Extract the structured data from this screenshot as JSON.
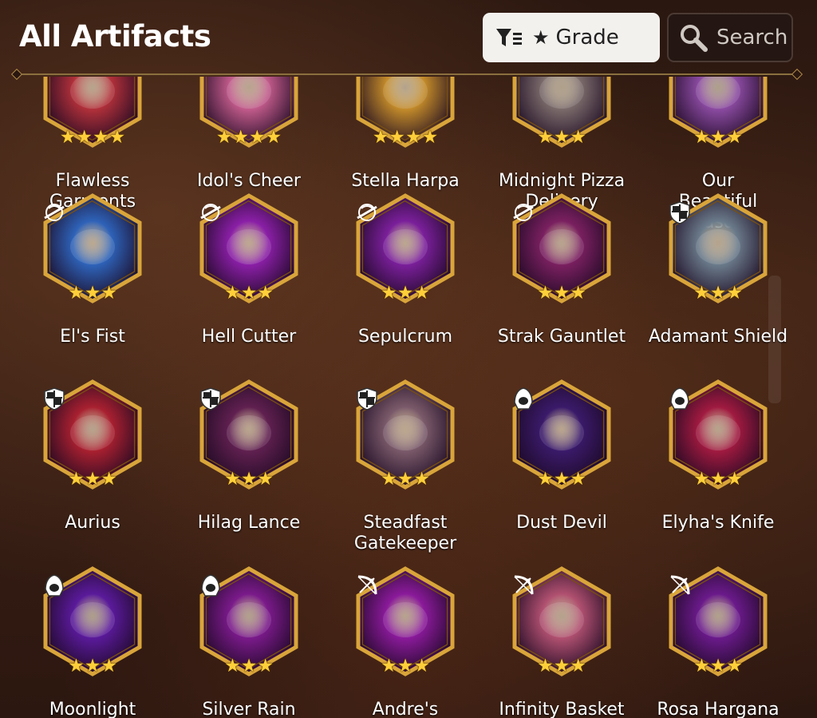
{
  "header": {
    "title": "All Artifacts",
    "grade_label": "Grade",
    "search_label": "Search"
  },
  "colors": {
    "gold": "#d9a53a",
    "star": "#ffcf3a"
  },
  "rows": [
    {
      "items": [
        {
          "name": "Flawless Garments",
          "stars": 4,
          "class_icon": "",
          "art": "#b0303a"
        },
        {
          "name": "Idol's Cheer",
          "stars": 4,
          "class_icon": "",
          "art": "#c05a8a"
        },
        {
          "name": "Stella Harpa",
          "stars": 4,
          "class_icon": "",
          "art": "#c28a2a"
        },
        {
          "name": "Midnight Pizza Delivery",
          "stars": 3,
          "class_icon": "",
          "art": "#7a6a6a"
        },
        {
          "name": "Our Beautiful Seasons",
          "stars": 3,
          "class_icon": "",
          "art": "#8a4aa0"
        }
      ]
    },
    {
      "items": [
        {
          "name": "El's Fist",
          "stars": 3,
          "class_icon": "soul-weaver-icon",
          "art": "#2e62b8"
        },
        {
          "name": "Hell Cutter",
          "stars": 3,
          "class_icon": "soul-weaver-icon",
          "art": "#8a1fa6"
        },
        {
          "name": "Sepulcrum",
          "stars": 3,
          "class_icon": "soul-weaver-icon",
          "art": "#7a1f9a"
        },
        {
          "name": "Strak Gauntlet",
          "stars": 3,
          "class_icon": "soul-weaver-icon",
          "art": "#7a2060"
        },
        {
          "name": "Adamant Shield",
          "stars": 3,
          "class_icon": "knight-shield-icon",
          "art": "#6a7a8a"
        }
      ]
    },
    {
      "items": [
        {
          "name": "Aurius",
          "stars": 3,
          "class_icon": "knight-shield-icon",
          "art": "#a82030"
        },
        {
          "name": "Hilag Lance",
          "stars": 3,
          "class_icon": "knight-shield-icon",
          "art": "#602050"
        },
        {
          "name": "Steadfast Gatekeeper",
          "stars": 3,
          "class_icon": "knight-shield-icon",
          "art": "#7a5a6a"
        },
        {
          "name": "Dust Devil",
          "stars": 3,
          "class_icon": "thief-hood-icon",
          "art": "#3a1a6a"
        },
        {
          "name": "Elyha's Knife",
          "stars": 3,
          "class_icon": "thief-hood-icon",
          "art": "#a01a40"
        }
      ]
    },
    {
      "items": [
        {
          "name": "Moonlight Dreamblade",
          "stars": 3,
          "class_icon": "thief-hood-icon",
          "art": "#5a1a9a"
        },
        {
          "name": "Silver Rain",
          "stars": 3,
          "class_icon": "thief-hood-icon",
          "art": "#7a1a8a"
        },
        {
          "name": "Andre's Crossbow",
          "stars": 3,
          "class_icon": "ranger-bow-icon",
          "art": "#8a1a9a"
        },
        {
          "name": "Infinity Basket",
          "stars": 3,
          "class_icon": "ranger-bow-icon",
          "art": "#b05070"
        },
        {
          "name": "Rosa Hargana",
          "stars": 3,
          "class_icon": "ranger-bow-icon",
          "art": "#6a1a8a"
        }
      ]
    }
  ]
}
